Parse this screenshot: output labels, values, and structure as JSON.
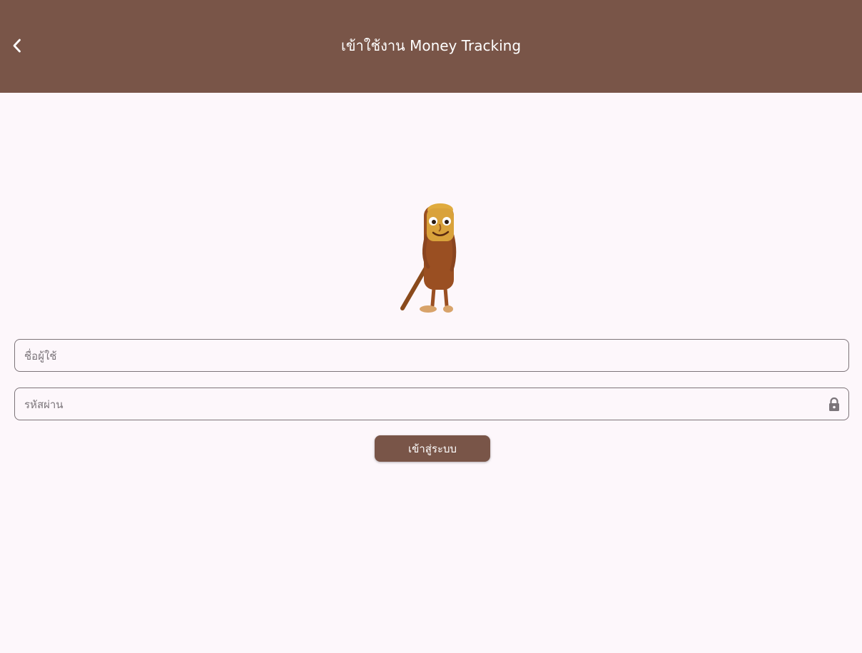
{
  "app_bar": {
    "title": "เข้าใช้งาน Money Tracking",
    "back_icon": "chevron-left-icon",
    "background_color": "#795548"
  },
  "login_form": {
    "username_placeholder": "ชื่อผู้ใช้",
    "password_placeholder": "รหัสผ่าน",
    "password_trailing_icon": "lock-icon",
    "submit_label": "เข้าสู่ระบบ"
  },
  "colors": {
    "accent": "#795548",
    "page_background": "#fdf7fb",
    "field_border": "#7d7479"
  }
}
